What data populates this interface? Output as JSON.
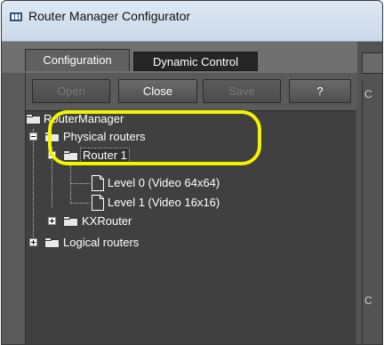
{
  "window": {
    "title": "Router Manager Configurator",
    "app_icon": "router-manager-icon"
  },
  "tabs": [
    {
      "label": "Configuration",
      "active": true
    },
    {
      "label": "Dynamic Control",
      "active": false
    }
  ],
  "toolbar": {
    "open_label": "Open",
    "close_label": "Close",
    "save_label": "Save",
    "help_label": "?"
  },
  "tree": {
    "root": "RouterManager",
    "physical": "Physical routers",
    "router1": "Router 1",
    "level0": "Level 0 (Video 64x64)",
    "level1": "Level 1 (Video 16x16)",
    "kxrouter": "KXRouter",
    "logical": "Logical routers"
  },
  "right_panel": {
    "label_a": "C",
    "label_b": "C"
  },
  "colors": {
    "highlight": "#f4f400",
    "panel_bg": "#404040",
    "chrome_bg": "#5a5a5a"
  }
}
